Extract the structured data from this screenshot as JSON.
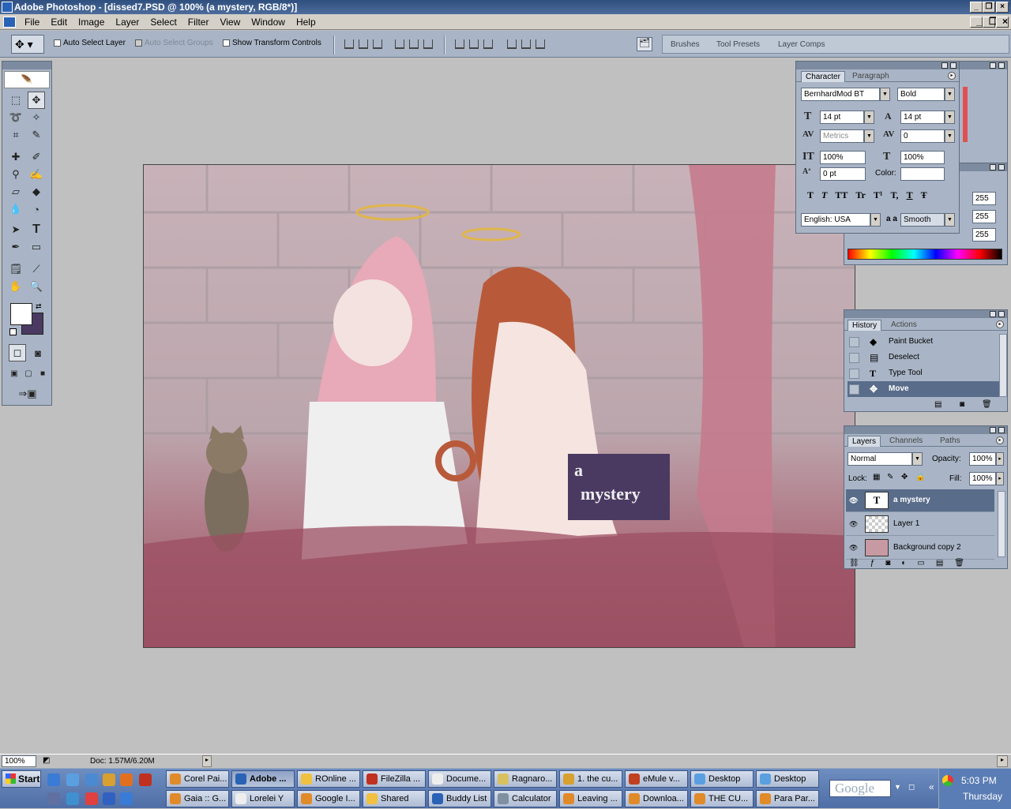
{
  "app": {
    "title": "Adobe Photoshop - [dissed7.PSD @ 100% (a  mystery, RGB/8*)]"
  },
  "menu": [
    "File",
    "Edit",
    "Image",
    "Layer",
    "Select",
    "Filter",
    "View",
    "Window",
    "Help"
  ],
  "options": {
    "auto_select_layer": "Auto Select Layer",
    "auto_select_groups": "Auto Select Groups",
    "show_transform": "Show Transform Controls"
  },
  "well": {
    "tabs": [
      "Brushes",
      "Tool Presets",
      "Layer Comps"
    ]
  },
  "canvas": {
    "text_line1": "a",
    "text_line2": "mystery"
  },
  "character": {
    "tabs": [
      "Character",
      "Paragraph"
    ],
    "font": "BernhardMod BT",
    "style": "Bold",
    "size": "14 pt",
    "leading": "14 pt",
    "kerning": "Metrics",
    "tracking": "0",
    "vscale": "100%",
    "hscale": "100%",
    "baseline": "0 pt",
    "color_label": "Color:",
    "language": "English: USA",
    "aa_label": "a a",
    "antialias": "Smooth",
    "styles": [
      "T",
      "T",
      "TT",
      "Tr",
      "T¹",
      "T,",
      "T",
      "Ŧ"
    ]
  },
  "color": {
    "r": "255",
    "g": "255",
    "b": "255"
  },
  "history": {
    "tabs": [
      "History",
      "Actions"
    ],
    "items": [
      {
        "label": "Paint Bucket",
        "icon": "paint-bucket"
      },
      {
        "label": "Deselect",
        "icon": "deselect"
      },
      {
        "label": "Type Tool",
        "icon": "type"
      },
      {
        "label": "Move",
        "icon": "move"
      }
    ]
  },
  "layers": {
    "tabs": [
      "Layers",
      "Channels",
      "Paths"
    ],
    "blend": "Normal",
    "opacity_label": "Opacity:",
    "opacity": "100%",
    "lock_label": "Lock:",
    "fill_label": "Fill:",
    "fill": "100%",
    "items": [
      {
        "name": "a  mystery",
        "thumb": "T"
      },
      {
        "name": "Layer 1",
        "thumb": ""
      },
      {
        "name": "Background copy 2",
        "thumb": ""
      }
    ]
  },
  "status": {
    "zoom": "100%",
    "doc": "Doc: 1.57M/6.20M"
  },
  "taskbar": {
    "start": "Start",
    "row1": [
      "Corel Pai...",
      "Adobe ...",
      "ROnline ...",
      "FileZilla ...",
      "Docume...",
      "Ragnaro...",
      "1. the cu...",
      "eMule v...",
      "Desktop",
      "Desktop"
    ],
    "row2": [
      "Gaia :: G...",
      "Lorelei Y",
      "Google I...",
      "Shared",
      "Buddy List",
      "Calculator",
      "Leaving ...",
      "Downloa...",
      "THE CU...",
      "Para Par..."
    ],
    "search": "Google",
    "clock": "5:03 PM",
    "day": "Thursday"
  },
  "colors": {
    "title_bar": "#3b5c8f",
    "panel": "#a9b5c6",
    "foreground": "#ffffff",
    "background": "#4a3a62"
  }
}
